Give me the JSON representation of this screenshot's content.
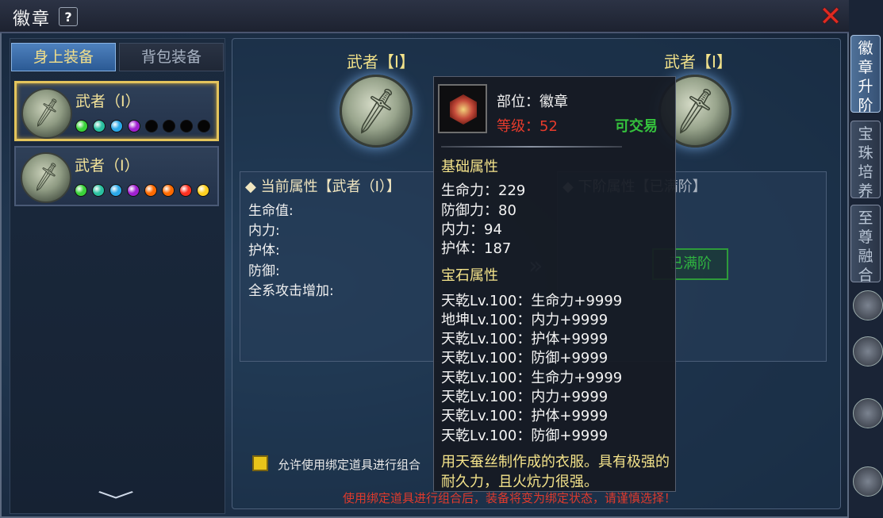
{
  "window": {
    "title": "徽章",
    "help_label": "?",
    "close_label": "✕"
  },
  "side_tabs": [
    "徽章升阶",
    "宝珠培养",
    "至尊融合"
  ],
  "left": {
    "tabs": {
      "equipped": "身上装备",
      "bag": "背包装备"
    },
    "slots": [
      {
        "name": "武者（I）",
        "gems": [
          "#3ad23a",
          "#2ac0a0",
          "#2aa8e8",
          "#a020d0",
          "#000000",
          "#000000",
          "#000000",
          "#000000"
        ]
      },
      {
        "name": "武者（I）",
        "gems": [
          "#3ad23a",
          "#2ac0a0",
          "#2aa8e8",
          "#a020d0",
          "#ff6a00",
          "#ff6a00",
          "#ff3020",
          "#ffd020"
        ]
      }
    ],
    "scroll_icon": "chevron-down-icon"
  },
  "main": {
    "left_header": "武者【I】",
    "right_header": "武者【I】",
    "current_title": "当前属性【武者（I）】",
    "current_rows": [
      "生命值:",
      "内力:",
      "护体:",
      "防御:",
      "全系攻击增加:"
    ],
    "next_title": "下阶属性【已满阶】",
    "maxed_button": "已满阶",
    "bind_label": "允许使用绑定道具进行组合",
    "warning": "使用绑定道具进行组合后，装备将变为绑定状态，请谨慎选择！"
  },
  "tooltip": {
    "slot": "部位：徽章",
    "level": "等级：52",
    "tradeable": "可交易",
    "basic_title": "基础属性",
    "basic": [
      "生命力：229",
      "防御力：80",
      "内力：94",
      "护体：187"
    ],
    "gem_title": "宝石属性",
    "gems": [
      "天乾Lv.100：生命力+9999",
      "地坤Lv.100：内力+9999",
      "天乾Lv.100：护体+9999",
      "天乾Lv.100：防御+9999",
      "天乾Lv.100：生命力+9999",
      "天乾Lv.100：内力+9999",
      "天乾Lv.100：护体+9999",
      "天乾Lv.100：防御+9999"
    ],
    "description": "用天蚕丝制作成的衣服。具有极强的耐久力，且火炕力很强。"
  },
  "colors": {
    "gold": "#f4e38a",
    "red": "#e63b2c",
    "green": "#35c23d"
  }
}
